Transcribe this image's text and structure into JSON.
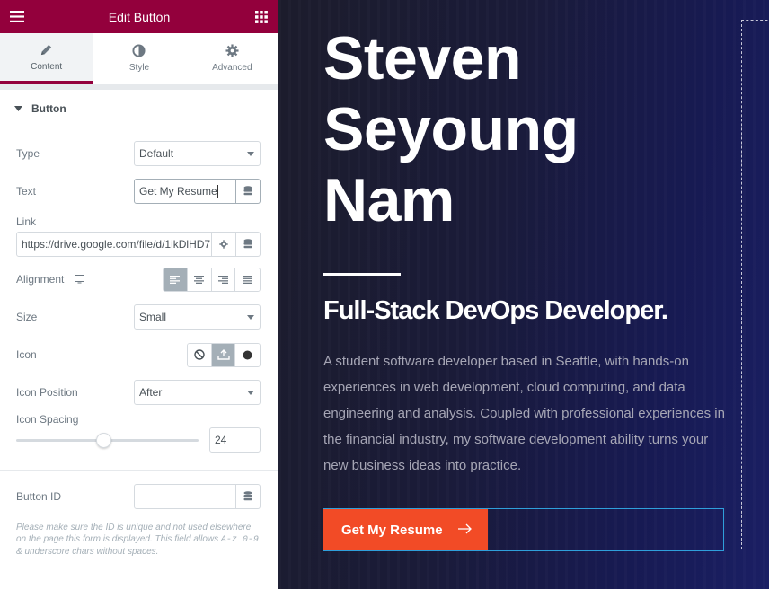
{
  "header": {
    "title": "Edit Button"
  },
  "tabs": [
    {
      "label": "Content",
      "icon": "pencil-icon"
    },
    {
      "label": "Style",
      "icon": "contrast-icon"
    },
    {
      "label": "Advanced",
      "icon": "gear-icon"
    }
  ],
  "section": {
    "title": "Button"
  },
  "fields": {
    "type": {
      "label": "Type",
      "value": "Default"
    },
    "text": {
      "label": "Text",
      "value": "Get My Resume"
    },
    "link": {
      "label": "Link",
      "value": "https://drive.google.com/file/d/1ikDlHD7"
    },
    "alignment": {
      "label": "Alignment",
      "options": [
        "left",
        "center",
        "right",
        "justify"
      ],
      "selected": "left"
    },
    "size": {
      "label": "Size",
      "value": "Small"
    },
    "icon": {
      "label": "Icon",
      "options": [
        "none",
        "upload",
        "icon-library"
      ],
      "selected": "upload"
    },
    "icon_position": {
      "label": "Icon Position",
      "value": "After"
    },
    "icon_spacing": {
      "label": "Icon Spacing",
      "value": "24",
      "slider_fraction": 0.48
    },
    "button_id": {
      "label": "Button ID",
      "value": ""
    }
  },
  "note": {
    "part1": "Please make sure the ID is unique and not used elsewhere on the page this form is displayed. This field allows ",
    "code": "A-z 0-9",
    "part2": " & underscore chars without spaces."
  },
  "preview": {
    "name_line1": "Steven",
    "name_line2": "Seyoung",
    "name_line3": "Nam",
    "subtitle": "Full-Stack DevOps Developer.",
    "description": "A student software developer based in Seattle, with hands-on experiences in web development, cloud computing, and data engineering and analysis. Coupled with professional experiences in the financial industry, my software development ability turns your new business ideas into practice.",
    "cta_label": "Get My Resume"
  },
  "colors": {
    "accent": "#93003c",
    "cta": "#f24b26"
  }
}
